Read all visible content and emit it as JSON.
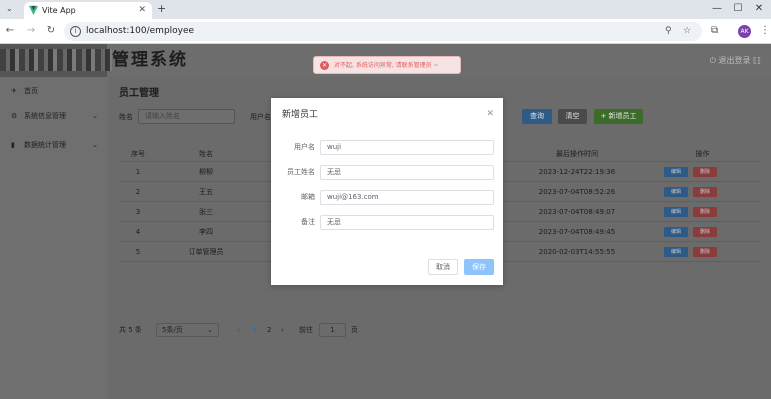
{
  "browser": {
    "tab_title": "Vite App",
    "url": "localhost:100/employee",
    "profile_initials": "AK"
  },
  "app": {
    "title": "管理系统",
    "logout": "退出登录",
    "sidebar": [
      {
        "icon": "paper-plane-icon",
        "label": "首页",
        "has_arrow": false
      },
      {
        "icon": "gear-icon",
        "label": "系统信息管理",
        "has_arrow": true
      },
      {
        "icon": "bar-chart-icon",
        "label": "数据统计管理",
        "has_arrow": true
      }
    ],
    "page_title": "员工管理",
    "filters": {
      "name_label": "姓名",
      "name_placeholder": "请输入姓名",
      "username_label": "用户名"
    },
    "buttons": {
      "search": "查询",
      "reset": "清空",
      "add": "+ 新增员工"
    },
    "table": {
      "columns": [
        "序号",
        "姓名",
        "最后操作时间",
        "操作"
      ],
      "rows": [
        {
          "index": "1",
          "name": "柳柳",
          "time": "2023-12-24T22:19:36"
        },
        {
          "index": "2",
          "name": "王五",
          "time": "2023-07-04T08:52:26"
        },
        {
          "index": "3",
          "name": "张三",
          "time": "2023-07-04T08:49:07"
        },
        {
          "index": "4",
          "name": "李四",
          "time": "2023-07-04T08:49:45"
        },
        {
          "index": "5",
          "name": "订单管理员",
          "time": "2020-02-03T14:55:55"
        }
      ],
      "edit_label": "编辑",
      "delete_label": "删除"
    },
    "pagination": {
      "total": "共 5 条",
      "page_size": "5条/页",
      "pages": [
        "1",
        "2"
      ],
      "goto_label": "前往",
      "goto_value": "1",
      "page_suffix": "页"
    },
    "colors": {
      "primary": "#409eff",
      "danger": "#f56c6c",
      "success": "#67c23a"
    }
  },
  "toast": {
    "type": "error",
    "message": "对不起, 系统访问异常, 请联系管理员 ~"
  },
  "dialog": {
    "title": "新增员工",
    "fields": [
      {
        "label": "用户名",
        "value": "wuji"
      },
      {
        "label": "员工姓名",
        "value": "无忌"
      },
      {
        "label": "邮箱",
        "value": "wuji@163.com"
      },
      {
        "label": "备注",
        "value": "无忌"
      }
    ],
    "cancel": "取消",
    "save": "保存"
  }
}
